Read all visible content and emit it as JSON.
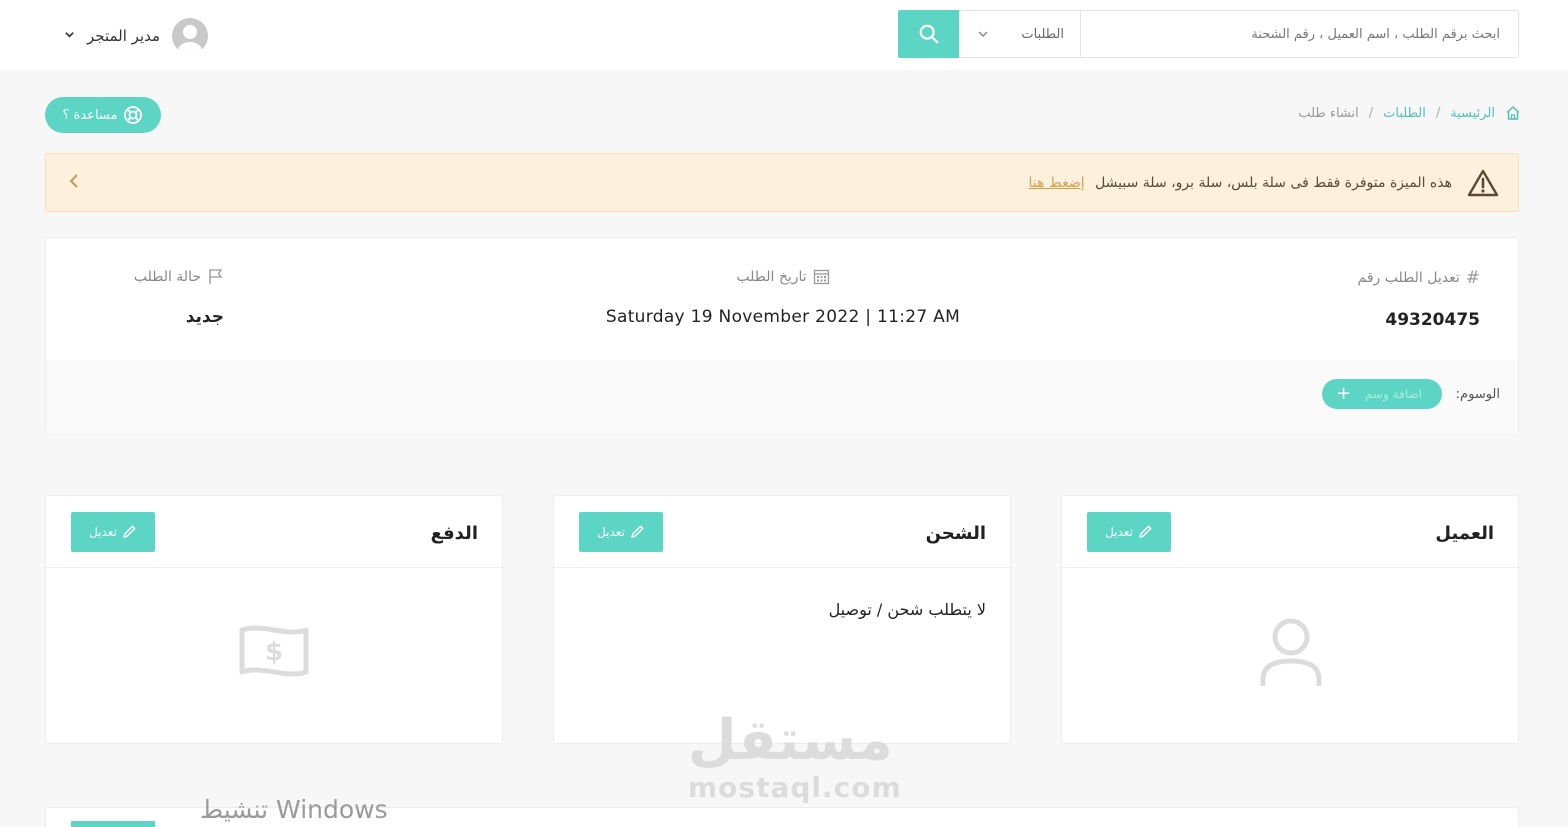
{
  "header": {
    "search": {
      "placeholder": "ابحث برقم الطلب ، اسم العميل ، رقم الشحنة",
      "category": "الطلبات"
    },
    "user": {
      "name": "مدير المتجر"
    }
  },
  "help": {
    "label": "مساعدة ؟"
  },
  "breadcrumb": {
    "home": "الرئيسية",
    "orders": "الطلبات",
    "current": "انشاء طلب"
  },
  "alert": {
    "message": "هذه الميزة متوفرة فقط فى سلة بلس، سلة برو، سلة سبيشل",
    "link": "إضغط هنا"
  },
  "order": {
    "number_label": "تعديل الطلب رقم",
    "number": "49320475",
    "date_label": "تاريخ الطلب",
    "date": "Saturday 19 November 2022 | 11:27 AM",
    "status_label": "حالة الطلب",
    "status": "جديد",
    "tags_label": "الوسوم:",
    "add_tag": "اضافة وسم"
  },
  "panels": {
    "customer": {
      "title": "العميل",
      "edit": "تعديل"
    },
    "shipping": {
      "title": "الشحن",
      "edit": "تعديل",
      "text": "لا يتطلب شحن / توصيل"
    },
    "payment": {
      "title": "الدفع",
      "edit": "تعديل"
    }
  },
  "watermark": {
    "ar": "مستقل",
    "en": "mostaql.com"
  },
  "os_notice": "تنشيط Windows",
  "colors": {
    "accent": "#5dd5c4",
    "alert_bg": "#fdf0dc",
    "alert_link": "#d4a24a"
  }
}
